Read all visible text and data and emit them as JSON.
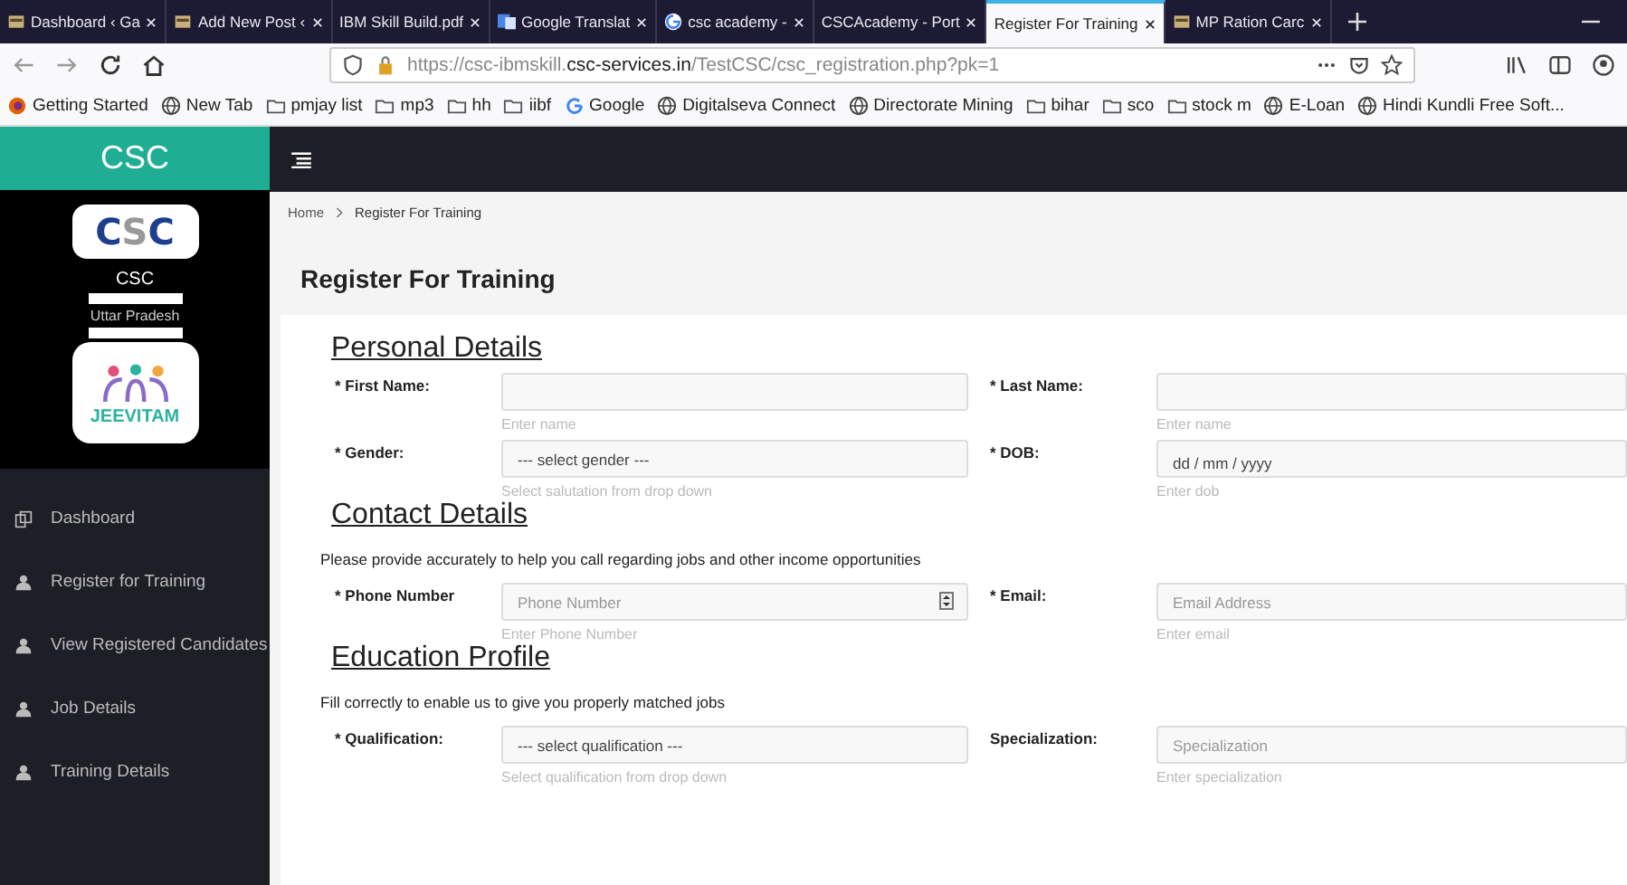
{
  "browser": {
    "tabs": [
      {
        "label": "Dashboard ‹ Ga",
        "kind": "site",
        "selected": false
      },
      {
        "label": "Add New Post ‹",
        "kind": "site",
        "selected": false
      },
      {
        "label": "IBM Skill Build.pdf",
        "kind": "plain",
        "selected": false
      },
      {
        "label": "Google Translat",
        "kind": "translate",
        "selected": false
      },
      {
        "label": "csc academy -",
        "kind": "google",
        "selected": false
      },
      {
        "label": "CSCAcademy - Port",
        "kind": "plain",
        "selected": false
      },
      {
        "label": "Register For Training",
        "kind": "plain",
        "selected": true
      },
      {
        "label": "MP Ration Carc",
        "kind": "site",
        "selected": false
      }
    ],
    "url": "https://csc-ibmskill.**csc-services.in**/TestCSC/csc_registration.php?pk=1",
    "bookmarks": [
      {
        "label": "Getting Started",
        "kind": "firefox"
      },
      {
        "label": "New Tab",
        "kind": "globe"
      },
      {
        "label": "pmjay list",
        "kind": "folder"
      },
      {
        "label": "mp3",
        "kind": "folder"
      },
      {
        "label": "hh",
        "kind": "folder"
      },
      {
        "label": "iibf",
        "kind": "folder"
      },
      {
        "label": "Google",
        "kind": "google"
      },
      {
        "label": "Digitalseva Connect",
        "kind": "globe"
      },
      {
        "label": "Directorate Mining",
        "kind": "globe"
      },
      {
        "label": "bihar",
        "kind": "folder"
      },
      {
        "label": "sco",
        "kind": "folder"
      },
      {
        "label": "stock m",
        "kind": "folder"
      },
      {
        "label": "E-Loan",
        "kind": "globe"
      },
      {
        "label": "Hindi Kundli Free Soft...",
        "kind": "globe"
      }
    ]
  },
  "sidebar": {
    "brand": "CSC",
    "logo_letters": [
      "C",
      "S",
      "C"
    ],
    "user_name": "CSC",
    "user_state": "Uttar Pradesh",
    "app_logo_text": "JEEVITAM",
    "menu": [
      {
        "label": "Dashboard",
        "kind": "dashboard"
      },
      {
        "label": "Register for Training",
        "kind": "user"
      },
      {
        "label": "View Registered Candidates",
        "kind": "user"
      },
      {
        "label": "Job Details",
        "kind": "user"
      },
      {
        "label": "Training Details",
        "kind": "user"
      }
    ]
  },
  "breadcrumb": [
    "Home",
    "Register For Training"
  ],
  "page_title": "Register For Training",
  "sections": [
    {
      "title": "Personal Details",
      "rows": [
        [
          {
            "label": "* First Name:",
            "kind": "text",
            "hint": "Enter name"
          },
          {
            "label": "* Last Name:",
            "kind": "text",
            "hint": "Enter name"
          }
        ],
        [
          {
            "label": "* Gender:",
            "kind": "select",
            "placeholder": "--- select gender ---",
            "hint": "Select salutation from drop down"
          },
          {
            "label": "* DOB:",
            "kind": "date",
            "placeholder": "dd / mm / yyyy",
            "hint": "Enter dob"
          }
        ]
      ]
    },
    {
      "title": "Contact Details",
      "note": "Please provide accurately to help you call regarding jobs and other income opportunities",
      "rows": [
        [
          {
            "label": "* Phone Number",
            "kind": "number",
            "placeholder": "Phone Number",
            "hint": "Enter Phone Number"
          },
          {
            "label": "* Email:",
            "kind": "text",
            "placeholder": "Email Address",
            "hint": "Enter email"
          }
        ]
      ]
    },
    {
      "title": "Education Profile",
      "note": "Fill correctly to enable us to give you properly matched jobs",
      "rows": [
        [
          {
            "label": "* Qualification:",
            "kind": "select",
            "placeholder": "--- select qualification ---",
            "hint": "Select qualification from drop down"
          },
          {
            "label": "Specialization:",
            "kind": "text",
            "placeholder": "Specialization",
            "hint": "Enter specialization"
          }
        ]
      ]
    }
  ]
}
